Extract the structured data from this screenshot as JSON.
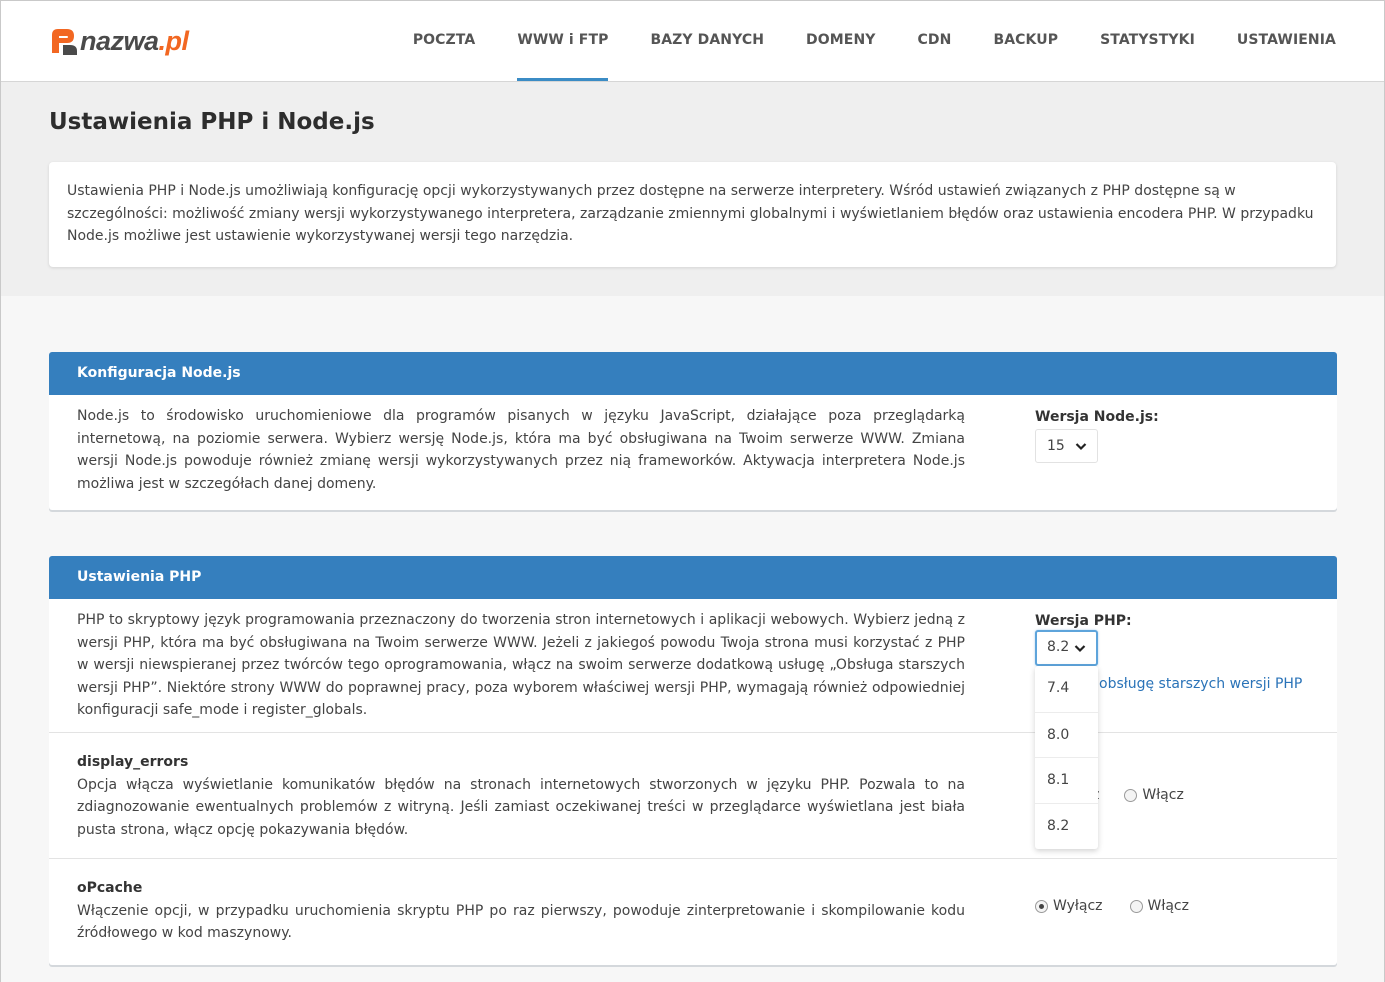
{
  "brand": {
    "name": "nazwa",
    "tld": ".pl"
  },
  "nav": {
    "items": [
      {
        "label": "POCZTA",
        "active": false
      },
      {
        "label": "WWW i FTP",
        "active": true
      },
      {
        "label": "BAZY DANYCH",
        "active": false
      },
      {
        "label": "DOMENY",
        "active": false
      },
      {
        "label": "CDN",
        "active": false
      },
      {
        "label": "BACKUP",
        "active": false
      },
      {
        "label": "STATYSTYKI",
        "active": false
      },
      {
        "label": "USTAWIENIA",
        "active": false
      }
    ]
  },
  "page": {
    "title": "Ustawienia PHP i Node.js",
    "intro": "Ustawienia PHP i Node.js umożliwiają konfigurację opcji wykorzystywanych przez dostępne na serwerze interpretery. Wśród ustawień związanych z PHP dostępne są w szczególności: możliwość zmiany wersji wykorzystywanego interpretera, zarządzanie zmiennymi globalnymi i wyświetlaniem błędów oraz ustawienia encodera PHP. W przypadku Node.js możliwe jest ustawienie wykorzystywanej wersji tego narzędzia."
  },
  "node_panel": {
    "header": "Konfiguracja Node.js",
    "description": "Node.js to środowisko uruchomieniowe dla programów pisanych w języku JavaScript, działające poza przeglądarką internetową, na poziomie serwera. Wybierz wersję Node.js, która ma być obsługiwana na Twoim serwerze WWW. Zmiana wersji Node.js powoduje również zmianę wersji wykorzystywanych przez nią frameworków. Aktywacja interpretera Node.js możliwa jest w szczegółach danej domeny.",
    "version_label": "Wersja Node.js:",
    "version_value": "15"
  },
  "php_panel": {
    "header": "Ustawienia PHP",
    "description": "PHP to skryptowy język programowania przeznaczony do tworzenia stron internetowych i aplikacji webowych. Wybierz jedną z wersji PHP, która ma być obsługiwana na Twoim serwerze WWW. Jeżeli z jakiegoś powodu Twoja strona musi korzystać z PHP w wersji niewspieranej przez twórców tego oprogramowania, włącz na swoim serwerze dodatkową usługę „Obsługa starszych wersji PHP”. Niektóre strony WWW do poprawnej pracy, poza wyborem właściwej wersji PHP, wymagają również odpowiedniej konfiguracji safe_mode i register_globals.",
    "version_label": "Wersja PHP:",
    "version_value": "8.2",
    "legacy_link_visible": "obsługę starszych wersji PHP",
    "dropdown_options": [
      "7.4",
      "8.0",
      "8.1",
      "8.2"
    ],
    "display_errors": {
      "title": "display_errors",
      "description": "Opcja włącza wyświetlanie komunikatów błędów na stronach internetowych stworzonych w języku PHP. Pozwala to na zdiagnozowanie ewentualnych problemów z witryną. Jeśli zamiast oczekiwanej treści w przeglądarce wyświetlana jest biała pusta strona, włącz opcję pokazywania błędów.",
      "off_label_visible": "z",
      "on_label": "Włącz"
    },
    "opcache": {
      "title": "oPcache",
      "description": "Włączenie opcji, w przypadku uruchomienia skryptu PHP po raz pierwszy, powoduje zinterpretowanie i skompilowanie kodu źródłowego w kod maszynowy.",
      "off_label": "Wyłącz",
      "on_label": "Włącz",
      "selected": "off"
    }
  },
  "colors": {
    "accent": "#357fbe",
    "brand_orange": "#f26722",
    "link": "#2a73b8"
  }
}
